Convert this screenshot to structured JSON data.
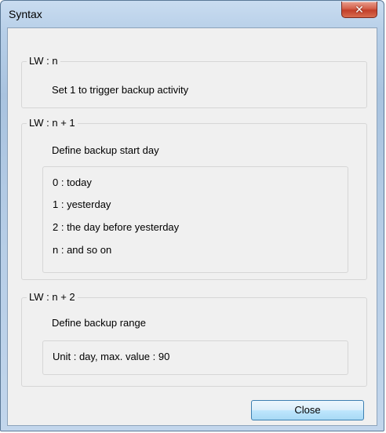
{
  "window": {
    "title": "Syntax"
  },
  "groups": [
    {
      "label": "LW : n",
      "description": "Set 1 to trigger backup activity"
    },
    {
      "label": "LW : n + 1",
      "description": "Define backup start day",
      "options": [
        "0 : today",
        "1 : yesterday",
        "2 : the day before yesterday",
        "n : and so on"
      ]
    },
    {
      "label": "LW : n + 2",
      "description": "Define backup range",
      "note": "Unit : day, max. value : 90"
    }
  ],
  "buttons": {
    "close_label": "Close"
  },
  "icons": {
    "window_close": "close-icon"
  }
}
